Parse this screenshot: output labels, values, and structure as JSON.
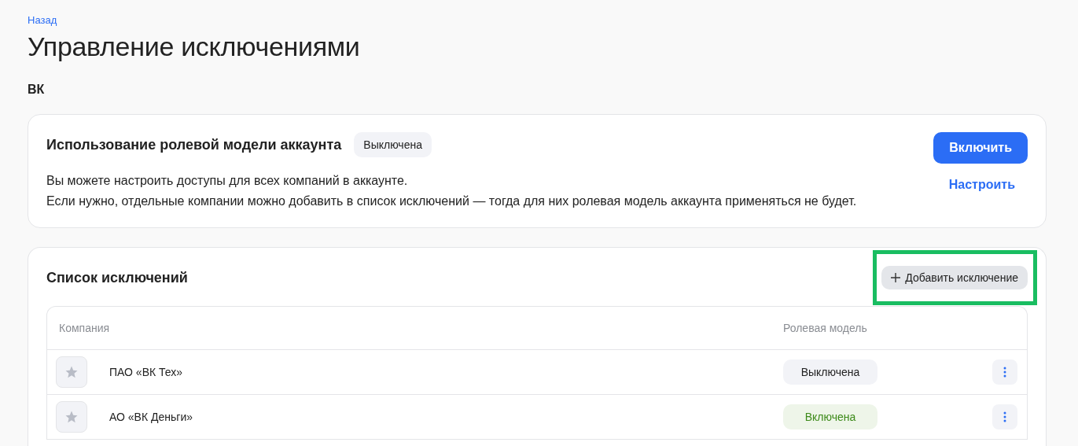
{
  "back_link": "Назад",
  "title": "Управление исключениями",
  "account": "ВК",
  "role_model_card": {
    "title": "Использование ролевой модели аккаунта",
    "status": {
      "label": "Выключена",
      "enabled": false
    },
    "description": [
      "Вы можете настроить доступы для всех компаний в аккаунте.",
      "Если нужно, отдельные компании можно добавить в список исключений — тогда для них ролевая модель аккаунта применяться не будет."
    ],
    "enable_button": "Включить",
    "configure_link": "Настроить"
  },
  "exceptions": {
    "title": "Список исключений",
    "add_button": {
      "label": "Добавить исключение",
      "highlighted": true
    },
    "table": {
      "columns": [
        "Компания",
        "Ролевая модель"
      ],
      "rows": [
        {
          "company": "ПАО «ВК Тех»",
          "role_model": {
            "label": "Выключена",
            "enabled": false
          }
        },
        {
          "company": "АО «ВК Деньги»",
          "role_model": {
            "label": "Включена",
            "enabled": true
          }
        }
      ]
    }
  }
}
